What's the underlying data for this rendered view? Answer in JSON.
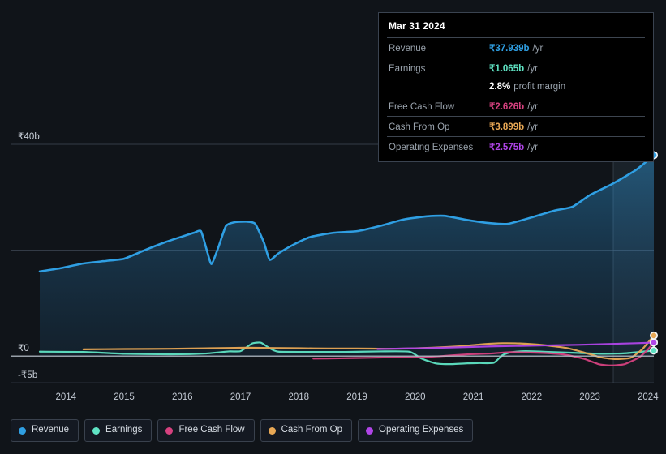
{
  "chart_data": {
    "type": "area",
    "title": "",
    "xlabel": "",
    "ylabel": "",
    "currency_symbol": "₹",
    "grid": true,
    "legend_position": "bottom",
    "x": [
      2013.55,
      2014,
      2015,
      2016,
      2017,
      2018,
      2019,
      2020,
      2021,
      2022,
      2023,
      2024.1
    ],
    "xlim": [
      2013.55,
      2024.1
    ],
    "ylim": [
      -5,
      40
    ],
    "y_ticks": [
      40,
      20,
      0,
      -5
    ],
    "y_tick_labels": [
      "₹40b",
      "",
      "₹0",
      "-₹5b"
    ],
    "x_tick_labels": [
      "2014",
      "2015",
      "2016",
      "2017",
      "2018",
      "2019",
      "2020",
      "2021",
      "2022",
      "2023",
      "2024"
    ],
    "forecast_band_start_year": 2023.4,
    "series": [
      {
        "name": "Revenue",
        "color": "#2f9fe3",
        "fill": true,
        "end_value": 37.939,
        "points": [
          [
            2013.55,
            16.0
          ],
          [
            2013.9,
            16.6
          ],
          [
            2014.3,
            17.5
          ],
          [
            2014.7,
            18.0
          ],
          [
            2015.0,
            18.4
          ],
          [
            2015.35,
            20.0
          ],
          [
            2015.7,
            21.5
          ],
          [
            2016.0,
            22.6
          ],
          [
            2016.2,
            23.3
          ],
          [
            2016.32,
            23.6
          ],
          [
            2016.42,
            20.0
          ],
          [
            2016.5,
            17.4
          ],
          [
            2016.62,
            20.6
          ],
          [
            2016.75,
            24.6
          ],
          [
            2016.9,
            25.3
          ],
          [
            2017.1,
            25.4
          ],
          [
            2017.25,
            25.0
          ],
          [
            2017.4,
            21.5
          ],
          [
            2017.5,
            18.2
          ],
          [
            2017.65,
            19.4
          ],
          [
            2017.9,
            21.0
          ],
          [
            2018.2,
            22.5
          ],
          [
            2018.6,
            23.3
          ],
          [
            2019.0,
            23.6
          ],
          [
            2019.4,
            24.6
          ],
          [
            2019.8,
            25.8
          ],
          [
            2020.2,
            26.4
          ],
          [
            2020.5,
            26.5
          ],
          [
            2020.9,
            25.7
          ],
          [
            2021.3,
            25.1
          ],
          [
            2021.6,
            25.0
          ],
          [
            2022.0,
            26.2
          ],
          [
            2022.4,
            27.5
          ],
          [
            2022.7,
            28.2
          ],
          [
            2023.0,
            30.4
          ],
          [
            2023.4,
            32.6
          ],
          [
            2023.8,
            35.2
          ],
          [
            2024.1,
            37.939
          ]
        ]
      },
      {
        "name": "Earnings",
        "color": "#5fe3c3",
        "fill": false,
        "end_value": 1.065,
        "points": [
          [
            2013.55,
            0.85
          ],
          [
            2014.3,
            0.8
          ],
          [
            2015.0,
            0.45
          ],
          [
            2015.8,
            0.35
          ],
          [
            2016.4,
            0.5
          ],
          [
            2016.8,
            0.9
          ],
          [
            2017.0,
            0.95
          ],
          [
            2017.2,
            2.4
          ],
          [
            2017.35,
            2.55
          ],
          [
            2017.5,
            1.5
          ],
          [
            2017.65,
            0.85
          ],
          [
            2018.2,
            0.8
          ],
          [
            2018.8,
            0.8
          ],
          [
            2019.4,
            0.9
          ],
          [
            2019.9,
            0.85
          ],
          [
            2020.1,
            -0.4
          ],
          [
            2020.35,
            -1.35
          ],
          [
            2020.6,
            -1.5
          ],
          [
            2020.9,
            -1.35
          ],
          [
            2021.1,
            -1.3
          ],
          [
            2021.35,
            -1.25
          ],
          [
            2021.5,
            0.2
          ],
          [
            2021.65,
            0.75
          ],
          [
            2021.9,
            0.95
          ],
          [
            2022.3,
            0.8
          ],
          [
            2022.8,
            0.6
          ],
          [
            2023.2,
            0.45
          ],
          [
            2023.6,
            0.55
          ],
          [
            2023.9,
            0.85
          ],
          [
            2024.1,
            1.065
          ]
        ]
      },
      {
        "name": "Free Cash Flow",
        "color": "#d6417f",
        "fill": false,
        "end_value": 2.626,
        "points": [
          [
            2018.25,
            -0.45
          ],
          [
            2018.7,
            -0.4
          ],
          [
            2019.2,
            -0.3
          ],
          [
            2019.7,
            -0.2
          ],
          [
            2020.1,
            -0.2
          ],
          [
            2020.5,
            0.05
          ],
          [
            2020.9,
            0.35
          ],
          [
            2021.3,
            0.5
          ],
          [
            2021.6,
            0.75
          ],
          [
            2021.9,
            0.7
          ],
          [
            2022.3,
            0.55
          ],
          [
            2022.6,
            0.25
          ],
          [
            2022.9,
            -0.5
          ],
          [
            2023.15,
            -1.5
          ],
          [
            2023.35,
            -1.75
          ],
          [
            2023.6,
            -1.5
          ],
          [
            2023.85,
            -0.2
          ],
          [
            2024.0,
            1.3
          ],
          [
            2024.1,
            2.626
          ]
        ]
      },
      {
        "name": "Cash From Op",
        "color": "#e8a855",
        "fill": false,
        "end_value": 3.899,
        "points": [
          [
            2014.3,
            1.3
          ],
          [
            2015.0,
            1.35
          ],
          [
            2015.8,
            1.4
          ],
          [
            2016.5,
            1.5
          ],
          [
            2017.1,
            1.6
          ],
          [
            2017.5,
            1.55
          ],
          [
            2018.0,
            1.5
          ],
          [
            2018.5,
            1.45
          ],
          [
            2019.0,
            1.45
          ],
          [
            2019.5,
            1.4
          ],
          [
            2019.9,
            1.45
          ],
          [
            2020.3,
            1.6
          ],
          [
            2020.8,
            1.9
          ],
          [
            2021.2,
            2.3
          ],
          [
            2021.5,
            2.45
          ],
          [
            2021.8,
            2.4
          ],
          [
            2022.2,
            2.1
          ],
          [
            2022.6,
            1.55
          ],
          [
            2022.9,
            0.7
          ],
          [
            2023.2,
            -0.25
          ],
          [
            2023.45,
            -0.55
          ],
          [
            2023.7,
            -0.3
          ],
          [
            2023.9,
            1.3
          ],
          [
            2024.1,
            3.899
          ]
        ]
      },
      {
        "name": "Operating Expenses",
        "color": "#b045e8",
        "fill": false,
        "end_value": 2.575,
        "points": [
          [
            2019.35,
            1.35
          ],
          [
            2019.8,
            1.45
          ],
          [
            2020.3,
            1.55
          ],
          [
            2020.8,
            1.7
          ],
          [
            2021.3,
            1.85
          ],
          [
            2021.8,
            1.95
          ],
          [
            2022.3,
            2.05
          ],
          [
            2022.8,
            2.15
          ],
          [
            2023.3,
            2.3
          ],
          [
            2023.8,
            2.45
          ],
          [
            2024.1,
            2.575
          ]
        ]
      }
    ]
  },
  "tooltip": {
    "name": "revenue-tooltip",
    "date": "Mar 31 2024",
    "rows": [
      {
        "key": "Revenue",
        "value": "₹37.939b",
        "unit": "/yr",
        "color": "#2f9fe3"
      },
      {
        "key": "Earnings",
        "value": "₹1.065b",
        "unit": "/yr",
        "color": "#5fe3c3"
      },
      {
        "key": "",
        "value": "2.8%",
        "unit": "profit margin",
        "color": "#ffffff"
      },
      {
        "key": "Free Cash Flow",
        "value": "₹2.626b",
        "unit": "/yr",
        "color": "#d6417f"
      },
      {
        "key": "Cash From Op",
        "value": "₹3.899b",
        "unit": "/yr",
        "color": "#e8a855"
      },
      {
        "key": "Operating Expenses",
        "value": "₹2.575b",
        "unit": "/yr",
        "color": "#b045e8"
      }
    ]
  },
  "legend": {
    "items": [
      {
        "label": "Revenue",
        "color": "#2f9fe3"
      },
      {
        "label": "Earnings",
        "color": "#5fe3c3"
      },
      {
        "label": "Free Cash Flow",
        "color": "#d6417f"
      },
      {
        "label": "Cash From Op",
        "color": "#e8a855"
      },
      {
        "label": "Operating Expenses",
        "color": "#b045e8"
      }
    ]
  }
}
